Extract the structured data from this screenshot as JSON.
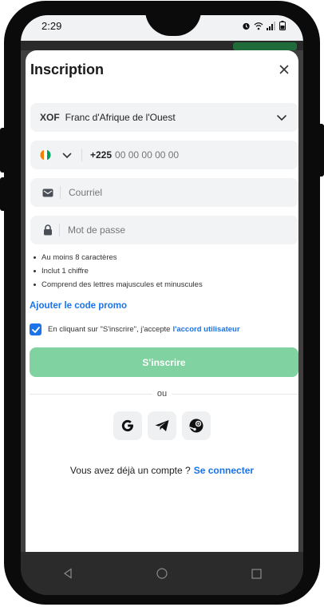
{
  "status_bar": {
    "time": "2:29"
  },
  "modal": {
    "title": "Inscription",
    "currency": {
      "code": "XOF",
      "name": "Franc d'Afrique de l'Ouest"
    },
    "phone": {
      "prefix": "+225",
      "placeholder": "00 00 00 00 00"
    },
    "email": {
      "placeholder": "Courriel"
    },
    "password": {
      "placeholder": "Mot de passe"
    },
    "password_rules": [
      "Au moins 8 caractères",
      "Inclut 1 chiffre",
      "Comprend des lettres majuscules et minuscules"
    ],
    "promo_link": "Ajouter le code promo",
    "agreement": {
      "checked": true,
      "text": "En cliquant sur \"S'inscrire\", j'accepte",
      "link": "l'accord utilisateur"
    },
    "submit_label": "S'inscrire",
    "divider_text": "ou",
    "socials": [
      "google-icon",
      "telegram-icon",
      "steam-icon"
    ],
    "login_prompt": "Vous avez déjà un compte ?",
    "login_link": "Se connecter"
  },
  "colors": {
    "accent": "#1a73e8",
    "submit_disabled": "#80d2a0",
    "field_bg": "#f2f3f5"
  }
}
